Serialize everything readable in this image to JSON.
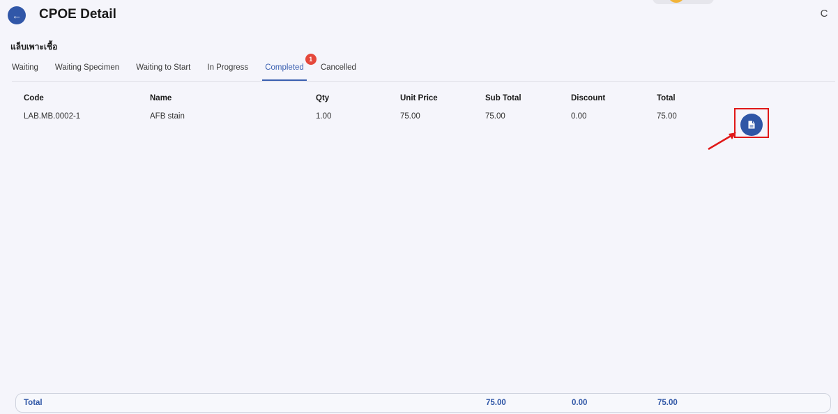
{
  "header": {
    "title": "CPOE Detail",
    "back_icon": "arrow-left-icon",
    "refresh_icon": "refresh-icon",
    "refresh_glyph": "C"
  },
  "section": {
    "label": "แล็บเพาะเชื้อ"
  },
  "tabs": [
    {
      "label": "Waiting",
      "active": false
    },
    {
      "label": "Waiting Specimen",
      "active": false
    },
    {
      "label": "Waiting to Start",
      "active": false
    },
    {
      "label": "In Progress",
      "active": false
    },
    {
      "label": "Completed",
      "active": true,
      "badge": "1"
    },
    {
      "label": "Cancelled",
      "active": false
    }
  ],
  "table": {
    "columns": [
      "Code",
      "Name",
      "Qty",
      "Unit Price",
      "Sub Total",
      "Discount",
      "Total"
    ],
    "rows": [
      {
        "code": "LAB.MB.0002-1",
        "name": "AFB stain",
        "qty": "1.00",
        "unit_price": "75.00",
        "sub_total": "75.00",
        "discount": "0.00",
        "total": "75.00",
        "action_icon": "document-icon"
      }
    ]
  },
  "footer": {
    "label": "Total",
    "sub_total": "75.00",
    "discount": "0.00",
    "total": "75.00"
  },
  "colors": {
    "primary": "#2f56a6",
    "badge": "#e5483b",
    "highlight": "#e01818",
    "background": "#f5f5fb"
  }
}
